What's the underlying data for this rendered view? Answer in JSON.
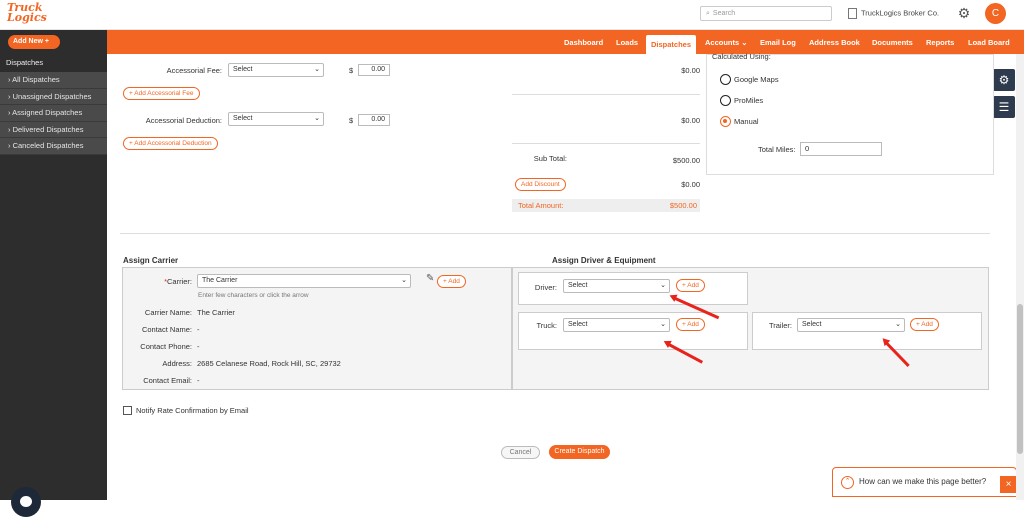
{
  "header": {
    "logo_top": "Truck",
    "logo_bottom": "Logics",
    "search_placeholder": "Search",
    "company": "TruckLogics Broker Co.",
    "avatar_letter": "C"
  },
  "sidebar": {
    "add_new": "Add New",
    "section": "Dispatches",
    "items": [
      {
        "label": "› All Dispatches"
      },
      {
        "label": "› Unassigned Dispatches"
      },
      {
        "label": "› Assigned Dispatches"
      },
      {
        "label": "› Delivered Dispatches"
      },
      {
        "label": "› Canceled Dispatches"
      }
    ]
  },
  "nav": {
    "items": [
      {
        "label": "Dashboard"
      },
      {
        "label": "Loads"
      },
      {
        "label": "Dispatches"
      },
      {
        "label": "Accounts ⌄"
      },
      {
        "label": "Email Log"
      },
      {
        "label": "Address Book"
      },
      {
        "label": "Documents"
      },
      {
        "label": "Reports"
      },
      {
        "label": "Load Board"
      }
    ],
    "active": "Dispatches"
  },
  "charges": {
    "accessorial_fee_label": "Accessorial Fee:",
    "accessorial_fee_select": "Select",
    "accessorial_fee_currency": "$",
    "accessorial_fee_value": "0.00",
    "accessorial_fee_amount": "$0.00",
    "add_accessorial_fee": "+ Add Accessorial Fee",
    "accessorial_deduction_label": "Accessorial Deduction:",
    "accessorial_deduction_select": "Select",
    "accessorial_deduction_currency": "$",
    "accessorial_deduction_value": "0.00",
    "accessorial_deduction_amount": "$0.00",
    "add_accessorial_deduction": "+ Add Accessorial Deduction",
    "sub_total_label": "Sub Total:",
    "sub_total_value": "$500.00",
    "add_discount": "Add Discount",
    "discount_value": "$0.00",
    "total_label": "Total Amount:",
    "total_value": "$500.00"
  },
  "calc": {
    "title": "Calculated Using:",
    "options": [
      {
        "label": "Google Maps",
        "selected": false
      },
      {
        "label": "ProMiles",
        "selected": false
      },
      {
        "label": "Manual",
        "selected": true
      }
    ],
    "total_miles_label": "Total Miles:",
    "total_miles_value": "0"
  },
  "carrier": {
    "heading": "Assign Carrier",
    "carrier_label": "*Carrier:",
    "carrier_value": "The Carrier",
    "hint": "Enter few characters or click the arrow",
    "add_label": "+ Add",
    "name_label": "Carrier Name:",
    "name_value": "The Carrier",
    "contact_name_label": "Contact Name:",
    "contact_name_value": "-",
    "contact_phone_label": "Contact Phone:",
    "contact_phone_value": "-",
    "address_label": "Address:",
    "address_value": "2685 Celanese Road, Rock Hill, SC, 29732",
    "contact_email_label": "Contact Email:",
    "contact_email_value": "-"
  },
  "driver": {
    "heading": "Assign Driver & Equipment",
    "driver_label": "Driver:",
    "driver_value": "Select",
    "truck_label": "Truck:",
    "truck_value": "Select",
    "trailer_label": "Trailer:",
    "trailer_value": "Select",
    "add_label": "+ Add"
  },
  "footer": {
    "notify_label": "Notify Rate Confirmation by Email",
    "cancel": "Cancel",
    "create": "Create Dispatch",
    "feedback": "How can we make this page better?",
    "close": "×"
  },
  "colors": {
    "accent": "#f26522",
    "sidebar": "#2d2d2d",
    "annotation_arrow": "#e8231c"
  }
}
